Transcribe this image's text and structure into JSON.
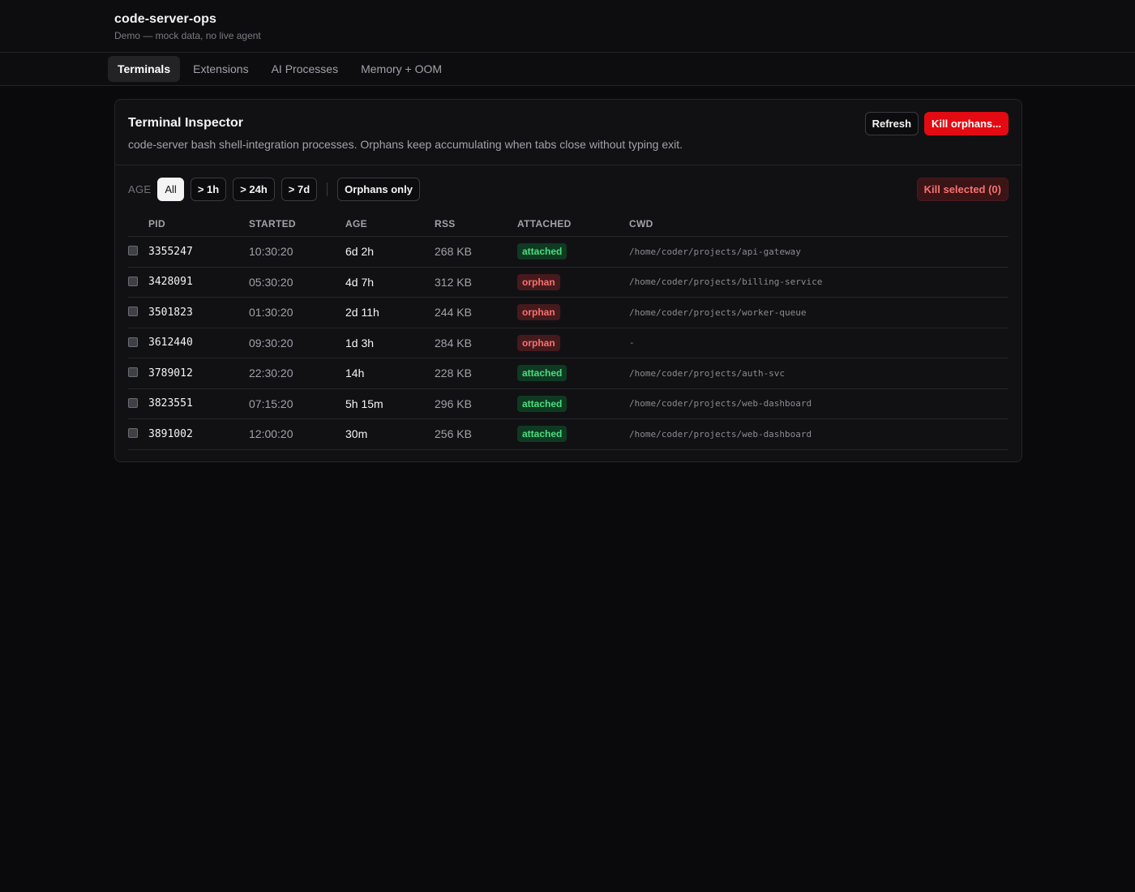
{
  "app": {
    "title": "code-server-ops",
    "subtitle": "Demo — mock data, no live agent"
  },
  "nav": {
    "tabs": [
      {
        "label": "Terminals",
        "active": true
      },
      {
        "label": "Extensions",
        "active": false
      },
      {
        "label": "AI Processes",
        "active": false
      },
      {
        "label": "Memory + OOM",
        "active": false
      }
    ]
  },
  "panel": {
    "title": "Terminal Inspector",
    "description": "code-server bash shell-integration processes. Orphans keep accumulating when tabs close without typing exit.",
    "refresh_label": "Refresh",
    "kill_orphans_label": "Kill orphans..."
  },
  "filters": {
    "age_label": "AGE",
    "age_options": [
      "All",
      "> 1h",
      "> 24h",
      "> 7d"
    ],
    "selected_age": "All",
    "orphans_only_label": "Orphans only",
    "kill_selected_label": "Kill selected (0)"
  },
  "table": {
    "headers": [
      "PID",
      "STARTED",
      "AGE",
      "RSS",
      "ATTACHED",
      "CWD"
    ],
    "rows": [
      {
        "pid": "3355247",
        "started": "10:30:20",
        "age": "6d 2h",
        "rss": "268 KB",
        "attached": "attached",
        "cwd": "/home/coder/projects/api-gateway"
      },
      {
        "pid": "3428091",
        "started": "05:30:20",
        "age": "4d 7h",
        "rss": "312 KB",
        "attached": "orphan",
        "cwd": "/home/coder/projects/billing-service"
      },
      {
        "pid": "3501823",
        "started": "01:30:20",
        "age": "2d 11h",
        "rss": "244 KB",
        "attached": "orphan",
        "cwd": "/home/coder/projects/worker-queue"
      },
      {
        "pid": "3612440",
        "started": "09:30:20",
        "age": "1d 3h",
        "rss": "284 KB",
        "attached": "orphan",
        "cwd": "-"
      },
      {
        "pid": "3789012",
        "started": "22:30:20",
        "age": "14h",
        "rss": "228 KB",
        "attached": "attached",
        "cwd": "/home/coder/projects/auth-svc"
      },
      {
        "pid": "3823551",
        "started": "07:15:20",
        "age": "5h 15m",
        "rss": "296 KB",
        "attached": "attached",
        "cwd": "/home/coder/projects/web-dashboard"
      },
      {
        "pid": "3891002",
        "started": "12:00:20",
        "age": "30m",
        "rss": "256 KB",
        "attached": "attached",
        "cwd": "/home/coder/projects/web-dashboard"
      }
    ]
  },
  "colors": {
    "background": "#0a0a0c",
    "danger": "#e30a12",
    "attached_text": "#4ade80",
    "orphan_text": "#f87171"
  }
}
